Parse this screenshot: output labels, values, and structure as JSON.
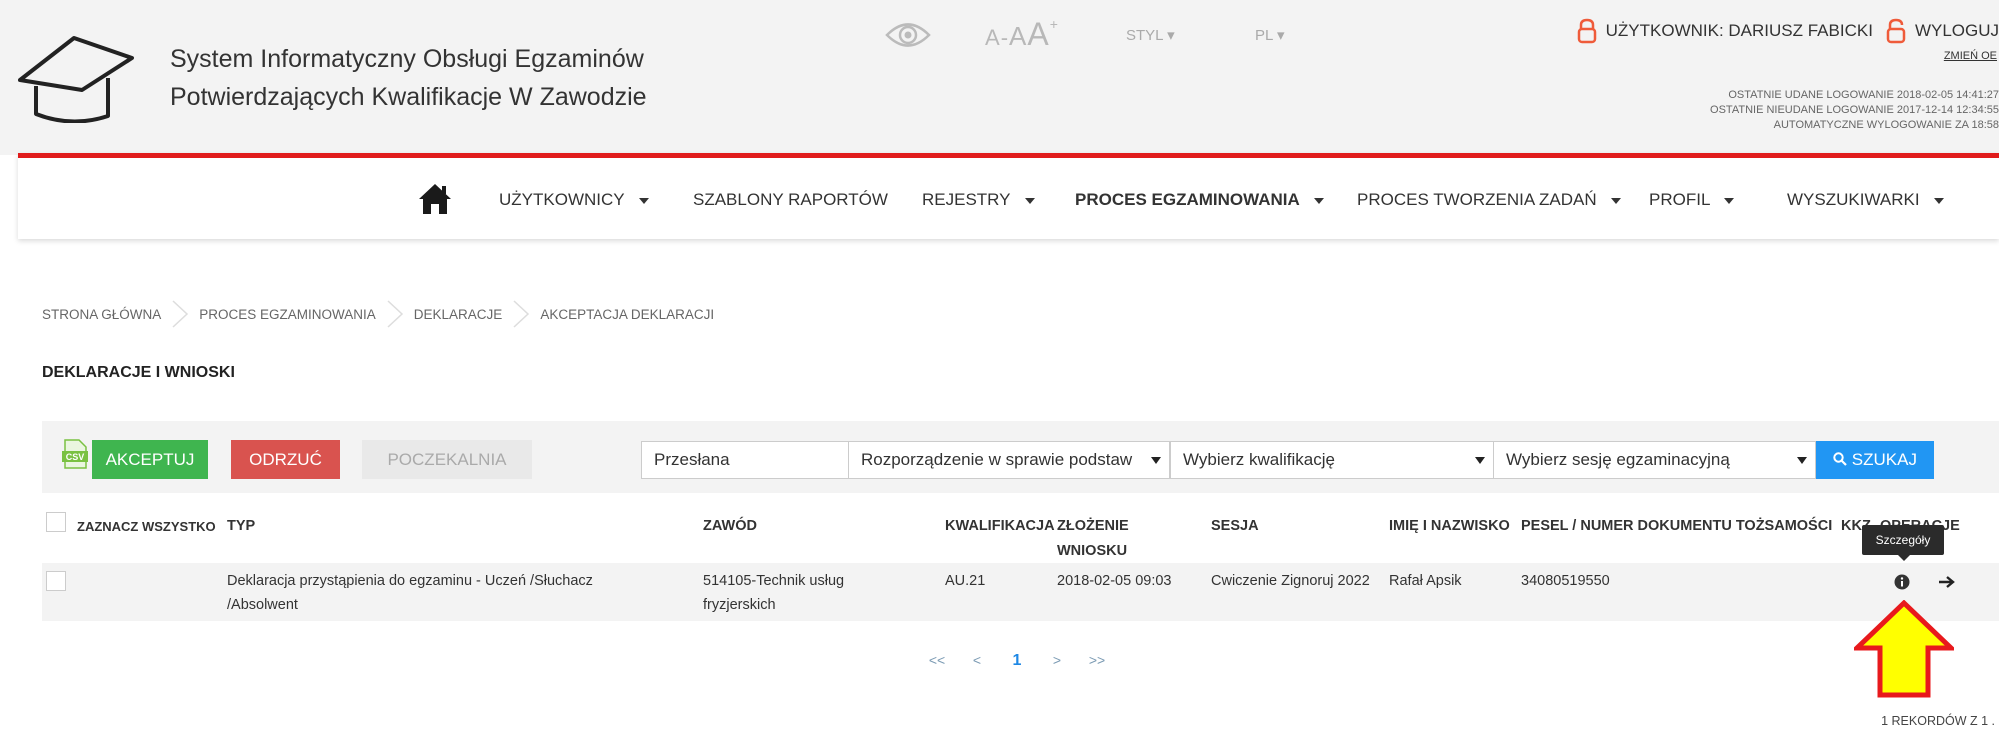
{
  "header": {
    "title_line1": "System Informatyczny Obsługi Egzaminów",
    "title_line2": "Potwierdzających Kwalifikacje W Zawodzie",
    "font_size_label": {
      "small": "A",
      "minus": "-",
      "medium": "A",
      "large": "A",
      "plus": "+"
    },
    "style_label": "STYL",
    "lang_label": "PL",
    "user_label": "UŻYTKOWNIK: DARIUSZ FABICKI",
    "logout_label": "WYLOGUJ",
    "change_link": "ZMIEŃ OE",
    "login_info": [
      "OSTATNIE UDANE LOGOWANIE 2018-02-05 14:41:27",
      "OSTATNIE NIEUDANE LOGOWANIE 2017-12-14 12:34:55",
      "AUTOMATYCZNE WYLOGOWANIE ZA  18:58"
    ]
  },
  "nav": {
    "items": [
      {
        "label": "UŻYTKOWNICY",
        "has_caret": true
      },
      {
        "label": "SZABLONY RAPORTÓW",
        "has_caret": false
      },
      {
        "label": "REJESTRY",
        "has_caret": true
      },
      {
        "label": "PROCES EGZAMINOWANIA",
        "has_caret": true,
        "active": true
      },
      {
        "label": "PROCES TWORZENIA ZADAŃ",
        "has_caret": true
      },
      {
        "label": "PROFIL",
        "has_caret": true
      },
      {
        "label": "WYSZUKIWARKI",
        "has_caret": true
      }
    ]
  },
  "breadcrumb": [
    "STRONA GŁÓWNA",
    "PROCES EGZAMINOWANIA",
    "DEKLARACJE",
    "AKCEPTACJA DEKLARACJI"
  ],
  "page_title": "DEKLARACJE I WNIOSKI",
  "toolbar": {
    "csv_label": "CSV",
    "accept": "AKCEPTUJ",
    "reject": "ODRZUĆ",
    "waiting": "POCZEKALNIA",
    "filter_status": "Przesłana",
    "filter_regulation": "Rozporządzenie w sprawie podstaw",
    "filter_qualification": "Wybierz kwalifikację",
    "filter_session": "Wybierz sesję egzaminacyjną",
    "search": "SZUKAJ"
  },
  "table": {
    "select_all": "ZAZNACZ WSZYSTKO",
    "columns": {
      "type": "TYP",
      "profession": "ZAWÓD",
      "qualification": "KWALIFIKACJA",
      "submission_line1": "ZŁOŻENIE",
      "submission_line2": "WNIOSKU",
      "session": "SESJA",
      "name": "IMIĘ I NAZWISKO",
      "pesel": "PESEL / NUMER DOKUMENTU TOŻSAMOŚCI",
      "kkz": "KKZ",
      "operations": "OPERACJE"
    },
    "rows": [
      {
        "type_line1": "Deklaracja przystąpienia do egzaminu - Uczeń /Słuchacz",
        "type_line2": "/Absolwent",
        "profession_line1": "514105-Technik usług",
        "profession_line2": "fryzjerskich",
        "qualification": "AU.21",
        "submission": "2018-02-05 09:03",
        "session": "Cwiczenie Zignoruj 2022",
        "name": "Rafał Apsik",
        "pesel": "34080519550"
      }
    ],
    "tooltip": "Szczegóły"
  },
  "pagination": {
    "first": "<<",
    "prev": "<",
    "current": "1",
    "next": ">",
    "last": ">>"
  },
  "records_text": "1   REKORDÓW Z   1   .",
  "colors": {
    "brand_red": "#e01b1b",
    "accept_green": "#3fb54f",
    "reject_red": "#d9534f",
    "search_blue": "#2196f3",
    "highlight_arrow_yellow": "#ffff00",
    "highlight_arrow_border": "#e8191c"
  }
}
